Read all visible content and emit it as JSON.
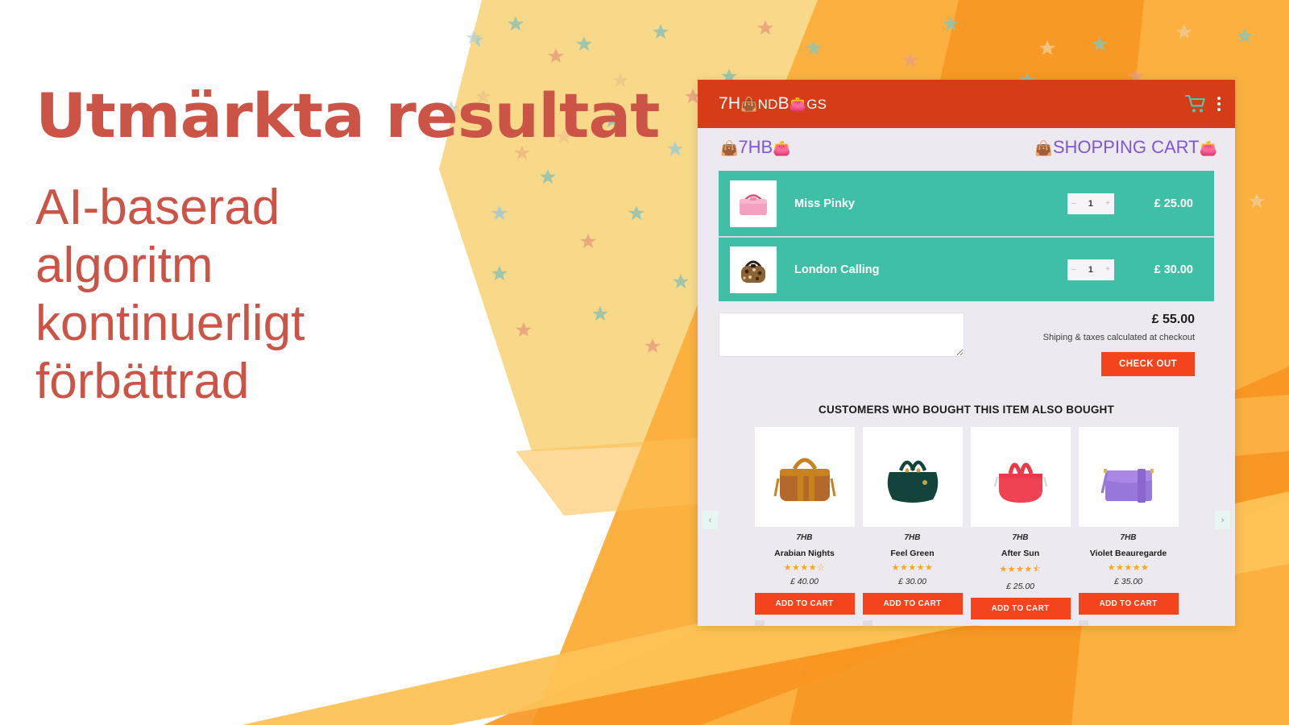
{
  "promo": {
    "headline": "Utmärkta resultat",
    "subline": "AI-baserad algoritm kontinuerligt förbättrad",
    "accent_color": "#cb5447"
  },
  "app": {
    "brand_prefix": "7H",
    "brand_mid": "ND",
    "brand_suffix": "GS",
    "brand_b": "B",
    "bag_icon_1": "bag-icon",
    "bag_icon_2": "bag-icon",
    "cart_icon": "shopping-cart-icon",
    "overflow_icon": "overflow-menu-icon",
    "appbar_color": "#d63c17"
  },
  "breadcrumb": {
    "home_label": "7HB",
    "page_label": "SHOPPING CART",
    "color": "#7e57d4"
  },
  "cart": {
    "bg_color": "#3fbfa5",
    "items": [
      {
        "name": "Miss Pinky",
        "qty": "1",
        "minus": "–",
        "plus": "+",
        "price": "£ 25.00",
        "thumb": "pink-handbag"
      },
      {
        "name": "London Calling",
        "qty": "1",
        "minus": "–",
        "plus": "+",
        "price": "£ 30.00",
        "thumb": "leopard-handbag"
      }
    ],
    "note_placeholder": "",
    "note_value": "",
    "grand_total": "£ 55.00",
    "shipping_note": "Shiping & taxes calculated at checkout",
    "checkout_label": "CHECK OUT",
    "checkout_color": "#f4441d"
  },
  "recommendations": {
    "title": "CUSTOMERS WHO BOUGHT THIS ITEM ALSO BOUGHT",
    "prev_label": "‹",
    "next_label": "›",
    "add_to_cart_label": "ADD TO CART",
    "items": [
      {
        "brand": "7HB",
        "name": "Arabian Nights",
        "rating": 4,
        "rating_text": "★★★★☆",
        "price": "£ 40.00",
        "color": "#c8821f",
        "kind": "tan-bowler-bag"
      },
      {
        "brand": "7HB",
        "name": "Feel Green",
        "rating": 5,
        "rating_text": "★★★★★",
        "price": "£ 30.00",
        "color": "#12443b",
        "kind": "green-tote-bag"
      },
      {
        "brand": "7HB",
        "name": "After Sun",
        "rating": 4.5,
        "rating_text": "★★★★⯪",
        "price": "£ 25.00",
        "color": "#e83b4a",
        "kind": "red-tote-bag"
      },
      {
        "brand": "7HB",
        "name": "Violet Beauregarde",
        "rating": 5,
        "rating_text": "★★★★★",
        "price": "£ 35.00",
        "color": "#9877db",
        "kind": "purple-satchel-bag"
      }
    ]
  },
  "background": {
    "star_field_color": "#f8d98a",
    "ray_colors": [
      "#fbb040",
      "#f89521",
      "#fdc256"
    ],
    "white_color": "#ffffff"
  }
}
